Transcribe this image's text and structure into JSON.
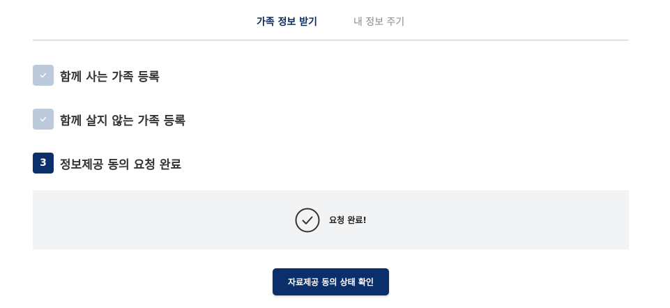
{
  "tabs": {
    "active_label": "가족 정보 받기",
    "inactive_label": "내 정보 주기"
  },
  "steps": [
    {
      "status": "done",
      "badge": "",
      "icon": "check-icon",
      "label": "함께 사는 가족 등록"
    },
    {
      "status": "done",
      "badge": "",
      "icon": "check-icon",
      "label": "함께 살지 않는 가족 등록"
    },
    {
      "status": "current",
      "badge": "3",
      "label": "정보제공 동의 요청 완료"
    }
  ],
  "result": {
    "icon": "check-circle-icon",
    "text": "요청 완료!"
  },
  "action": {
    "button_label": "자료제공 동의 상태 확인"
  },
  "colors": {
    "primary": "#0a2f6b",
    "done_badge": "#bccadc",
    "result_bg": "#f2f3f5"
  }
}
